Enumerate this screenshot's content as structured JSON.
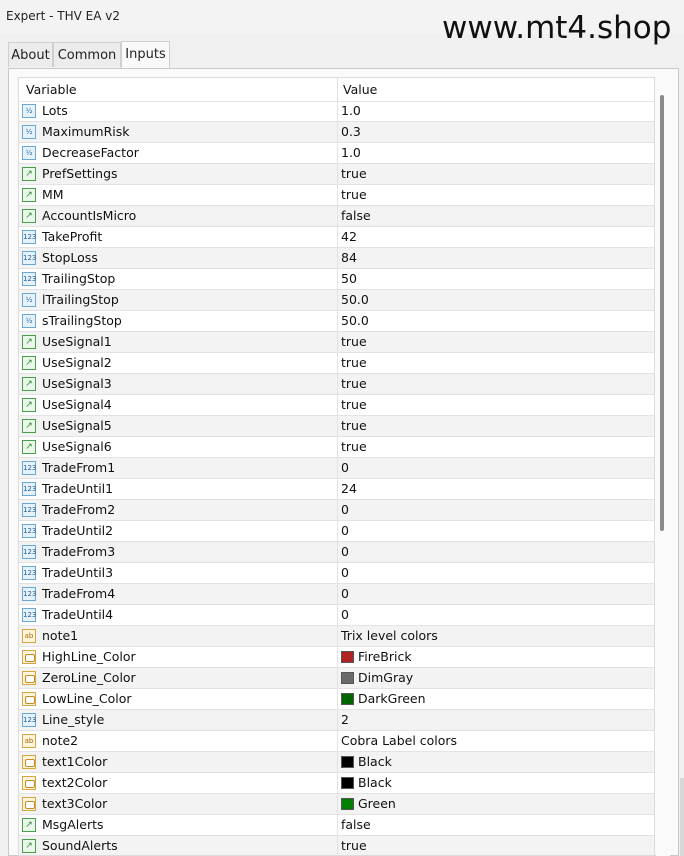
{
  "window": {
    "title": "Expert - THV EA v2",
    "watermark": "www.mt4.shop"
  },
  "tabs": [
    {
      "label": "About",
      "active": false
    },
    {
      "label": "Common",
      "active": false
    },
    {
      "label": "Inputs",
      "active": true
    }
  ],
  "grid": {
    "headers": {
      "variable": "Variable",
      "value": "Value"
    },
    "rows": [
      {
        "name": "Lots",
        "value": "1.0",
        "type": "double",
        "icon_label": "½"
      },
      {
        "name": "MaximumRisk",
        "value": "0.3",
        "type": "double",
        "icon_label": "½"
      },
      {
        "name": "DecreaseFactor",
        "value": "1.0",
        "type": "double",
        "icon_label": "½"
      },
      {
        "name": "PrefSettings",
        "value": "true",
        "type": "bool",
        "icon_label": ""
      },
      {
        "name": "MM",
        "value": "true",
        "type": "bool",
        "icon_label": ""
      },
      {
        "name": "AccountIsMicro",
        "value": "false",
        "type": "bool",
        "icon_label": ""
      },
      {
        "name": "TakeProfit",
        "value": "42",
        "type": "int",
        "icon_label": "123"
      },
      {
        "name": "StopLoss",
        "value": "84",
        "type": "int",
        "icon_label": "123"
      },
      {
        "name": "TrailingStop",
        "value": "50",
        "type": "int",
        "icon_label": "123"
      },
      {
        "name": "lTrailingStop",
        "value": "50.0",
        "type": "double",
        "icon_label": "½"
      },
      {
        "name": "sTrailingStop",
        "value": "50.0",
        "type": "double",
        "icon_label": "½"
      },
      {
        "name": "UseSignal1",
        "value": "true",
        "type": "bool",
        "icon_label": ""
      },
      {
        "name": "UseSignal2",
        "value": "true",
        "type": "bool",
        "icon_label": ""
      },
      {
        "name": "UseSignal3",
        "value": "true",
        "type": "bool",
        "icon_label": ""
      },
      {
        "name": "UseSignal4",
        "value": "true",
        "type": "bool",
        "icon_label": ""
      },
      {
        "name": "UseSignal5",
        "value": "true",
        "type": "bool",
        "icon_label": ""
      },
      {
        "name": "UseSignal6",
        "value": "true",
        "type": "bool",
        "icon_label": ""
      },
      {
        "name": "TradeFrom1",
        "value": "0",
        "type": "int",
        "icon_label": "123"
      },
      {
        "name": "TradeUntil1",
        "value": "24",
        "type": "int",
        "icon_label": "123"
      },
      {
        "name": "TradeFrom2",
        "value": "0",
        "type": "int",
        "icon_label": "123"
      },
      {
        "name": "TradeUntil2",
        "value": "0",
        "type": "int",
        "icon_label": "123"
      },
      {
        "name": "TradeFrom3",
        "value": "0",
        "type": "int",
        "icon_label": "123"
      },
      {
        "name": "TradeUntil3",
        "value": "0",
        "type": "int",
        "icon_label": "123"
      },
      {
        "name": "TradeFrom4",
        "value": "0",
        "type": "int",
        "icon_label": "123"
      },
      {
        "name": "TradeUntil4",
        "value": "0",
        "type": "int",
        "icon_label": "123"
      },
      {
        "name": "note1",
        "value": "Trix level colors",
        "type": "string",
        "icon_label": "ab"
      },
      {
        "name": "HighLine_Color",
        "value": "FireBrick",
        "type": "color",
        "icon_label": "",
        "swatch": "#b22222"
      },
      {
        "name": "ZeroLine_Color",
        "value": "DimGray",
        "type": "color",
        "icon_label": "",
        "swatch": "#696969"
      },
      {
        "name": "LowLine_Color",
        "value": "DarkGreen",
        "type": "color",
        "icon_label": "",
        "swatch": "#006400"
      },
      {
        "name": "Line_style",
        "value": "2",
        "type": "int",
        "icon_label": "123"
      },
      {
        "name": "note2",
        "value": "Cobra Label colors",
        "type": "string",
        "icon_label": "ab"
      },
      {
        "name": "text1Color",
        "value": "Black",
        "type": "color",
        "icon_label": "",
        "swatch": "#000000"
      },
      {
        "name": "text2Color",
        "value": "Black",
        "type": "color",
        "icon_label": "",
        "swatch": "#000000"
      },
      {
        "name": "text3Color",
        "value": "Green",
        "type": "color",
        "icon_label": "",
        "swatch": "#008000"
      },
      {
        "name": "MsgAlerts",
        "value": "false",
        "type": "bool",
        "icon_label": ""
      },
      {
        "name": "SoundAlerts",
        "value": "true",
        "type": "bool",
        "icon_label": ""
      }
    ]
  }
}
